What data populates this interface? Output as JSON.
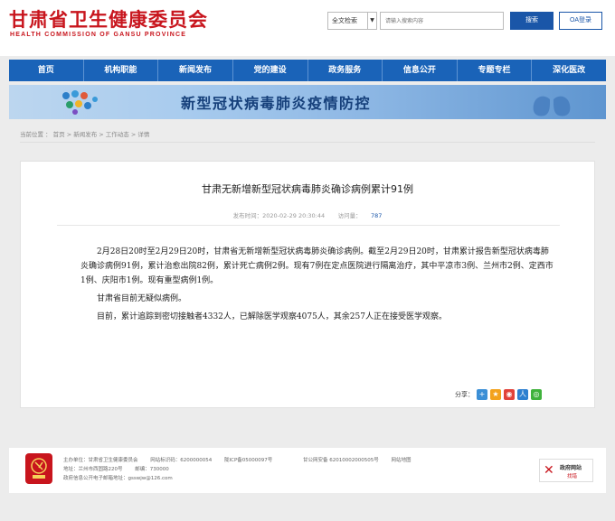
{
  "header": {
    "title": "甘肃省卫生健康委员会",
    "subtitle": "HEALTH  COMMISSION  OF  GANSU PROVINCE",
    "search_scope": "全文检索",
    "search_placeholder": "请输入搜索内容",
    "search_button": "搜索",
    "oa_button": "OA登录"
  },
  "nav": [
    "首页",
    "机构职能",
    "新闻发布",
    "党的建设",
    "政务服务",
    "信息公开",
    "专题专栏",
    "深化医改"
  ],
  "banner": {
    "title": "新型冠状病毒肺炎疫情防控"
  },
  "breadcrumb": "当前位置 ： 首页 > 新闻发布 > 工作动态 > 详情",
  "article": {
    "title": "甘肃无新增新型冠状病毒肺炎确诊病例累计91例",
    "date_label": "发布时间：",
    "date": "2020-02-29 20:30:44",
    "views_label": "访问量：",
    "views": "787",
    "paragraphs": [
      "2月28日20时至2月29日20时，甘肃省无新增新型冠状病毒肺炎确诊病例。截至2月29日20时，甘肃累计报告新型冠状病毒肺炎确诊病例91例，累计治愈出院82例，累计死亡病例2例。现有7例在定点医院进行隔离治疗，其中平凉市3例、兰州市2例、定西市1例、庆阳市1例。现有重型病例1例。",
      "甘肃省目前无疑似病例。",
      "目前，累计追踪到密切接触者4332人，已解除医学观察4075人，其余257人正在接受医学观察。"
    ],
    "share_label": "分享："
  },
  "footer": {
    "sponsor": "主办单位：甘肃省卫生健康委员会",
    "site_code": "网站标识码：6200000054",
    "icp": "陇ICP备05000097号",
    "gongan": "甘公网安备 62010002000505号",
    "sitemap": "网站地图",
    "address": "地址：兰州市西固路220号",
    "postcode": "邮编：730000",
    "email": "政府信息公开电子邮箱地址：gsswjw@126.com",
    "badge_line1": "政府网站",
    "badge_line2": "找错"
  },
  "colors": {
    "brand_red": "#c8151d",
    "nav_blue": "#1a63b8",
    "button_blue": "#1a56a8"
  }
}
